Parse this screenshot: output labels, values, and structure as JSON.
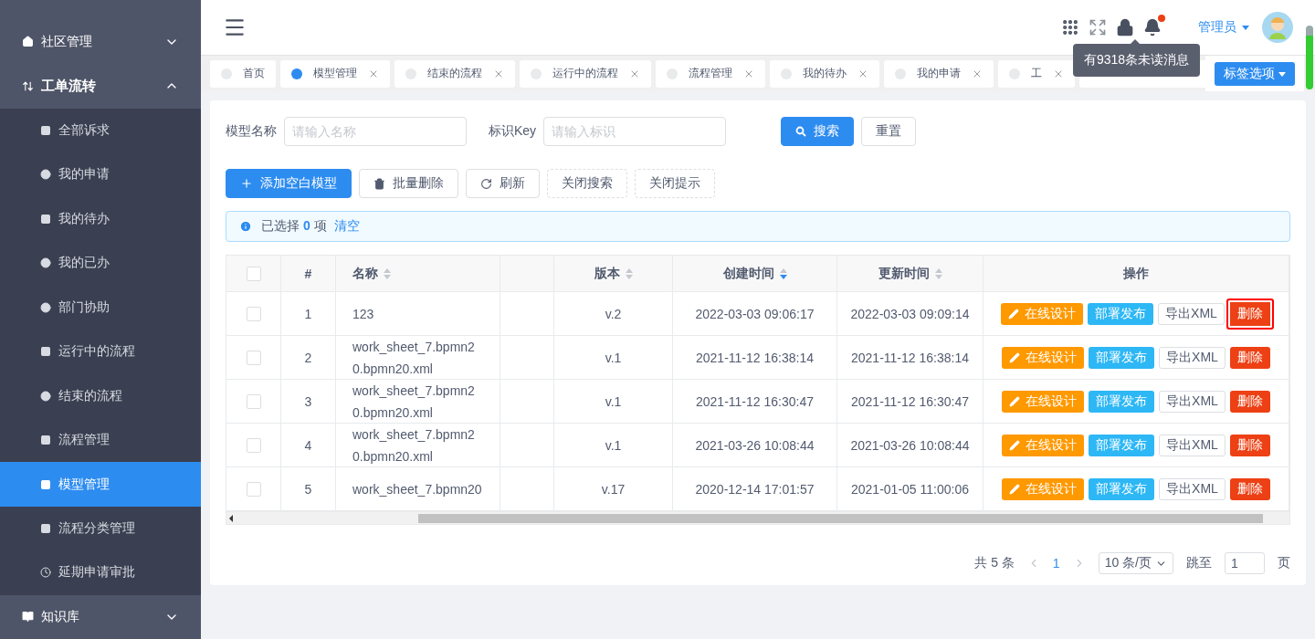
{
  "sidebar": {
    "items": [
      {
        "label": "社区管理",
        "expanded": false
      },
      {
        "label": "工单流转",
        "expanded": true,
        "children": [
          {
            "label": "全部诉求",
            "selected": false
          },
          {
            "label": "我的申请",
            "selected": false
          },
          {
            "label": "我的待办",
            "selected": false
          },
          {
            "label": "我的已办",
            "selected": false
          },
          {
            "label": "部门协助",
            "selected": false
          },
          {
            "label": "运行中的流程",
            "selected": false
          },
          {
            "label": "结束的流程",
            "selected": false
          },
          {
            "label": "流程管理",
            "selected": false
          },
          {
            "label": "模型管理",
            "selected": true
          },
          {
            "label": "流程分类管理",
            "selected": false
          },
          {
            "label": "延期申请审批",
            "selected": false
          }
        ]
      },
      {
        "label": "知识库",
        "expanded": false
      }
    ]
  },
  "header": {
    "user": "管理员",
    "notification_tooltip": "有9318条未读消息",
    "has_unread": true
  },
  "tabs": [
    {
      "label": "首页",
      "selected": false,
      "closable": false
    },
    {
      "label": "模型管理",
      "selected": true,
      "closable": true
    },
    {
      "label": "结束的流程",
      "selected": false,
      "closable": true
    },
    {
      "label": "运行中的流程",
      "selected": false,
      "closable": true
    },
    {
      "label": "流程管理",
      "selected": false,
      "closable": true
    },
    {
      "label": "我的待办",
      "selected": false,
      "closable": true
    },
    {
      "label": "我的申请",
      "selected": false,
      "closable": true
    },
    {
      "label": "工",
      "selected": false,
      "closable": true
    }
  ],
  "tab_options": "标签选项",
  "search": {
    "fields": [
      {
        "label": "模型名称",
        "placeholder": "请输入名称"
      },
      {
        "label": "标识Key",
        "placeholder": "请输入标识"
      }
    ],
    "search_button": "搜索",
    "reset_button": "重置"
  },
  "toolbar": [
    {
      "label": "添加空白模型",
      "kind": "primary"
    },
    {
      "label": "批量删除",
      "kind": "trash"
    },
    {
      "label": "刷新",
      "kind": "refresh"
    },
    {
      "label": "关闭搜索",
      "kind": "dashed"
    },
    {
      "label": "关闭提示",
      "kind": "dashed"
    }
  ],
  "selection_alert": {
    "prefix": "已选择",
    "count": "0",
    "suffix": "项",
    "clear": "清空"
  },
  "table": {
    "all_checked": false,
    "columns": [
      {
        "kind": "select"
      },
      {
        "label": "#"
      },
      {
        "label": "名称",
        "sorted_descending": false
      },
      {
        "kind": "blank"
      },
      {
        "label": "版本",
        "sorted_descending": false
      },
      {
        "label": "创建时间",
        "sorted_descending": true
      },
      {
        "label": "更新时间",
        "sorted_descending": false
      },
      {
        "label": "操作"
      }
    ],
    "rows": [
      {
        "checked": false,
        "index": "1",
        "name": "123",
        "version": "v.2",
        "created": "2022-03-03 09:06:17",
        "updated": "2022-03-03 09:09:14",
        "highlighted": true,
        "actions": [
          {
            "label": "在线设计",
            "kind": "design"
          },
          {
            "label": "部署发布",
            "kind": "deploy"
          },
          {
            "label": "导出XML",
            "kind": "export"
          },
          {
            "label": "删除",
            "kind": "delete"
          }
        ]
      },
      {
        "checked": false,
        "index": "2",
        "name": "work_sheet_7.bpmn20.bpmn20.xml",
        "version": "v.1",
        "created": "2021-11-12 16:38:14",
        "updated": "2021-11-12 16:38:14",
        "highlighted": false,
        "actions": [
          {
            "label": "在线设计",
            "kind": "design"
          },
          {
            "label": "部署发布",
            "kind": "deploy"
          },
          {
            "label": "导出XML",
            "kind": "export"
          },
          {
            "label": "删除",
            "kind": "delete"
          }
        ]
      },
      {
        "checked": false,
        "index": "3",
        "name": "work_sheet_7.bpmn20.bpmn20.xml",
        "version": "v.1",
        "created": "2021-11-12 16:30:47",
        "updated": "2021-11-12 16:30:47",
        "highlighted": false,
        "actions": [
          {
            "label": "在线设计",
            "kind": "design"
          },
          {
            "label": "部署发布",
            "kind": "deploy"
          },
          {
            "label": "导出XML",
            "kind": "export"
          },
          {
            "label": "删除",
            "kind": "delete"
          }
        ]
      },
      {
        "checked": false,
        "index": "4",
        "name": "work_sheet_7.bpmn20.bpmn20.xml",
        "version": "v.1",
        "created": "2021-03-26 10:08:44",
        "updated": "2021-03-26 10:08:44",
        "highlighted": false,
        "actions": [
          {
            "label": "在线设计",
            "kind": "design"
          },
          {
            "label": "部署发布",
            "kind": "deploy"
          },
          {
            "label": "导出XML",
            "kind": "export"
          },
          {
            "label": "删除",
            "kind": "delete"
          }
        ]
      },
      {
        "checked": false,
        "index": "5",
        "name": "work_sheet_7.bpmn20",
        "version": "v.17",
        "created": "2020-12-14 17:01:57",
        "updated": "2021-01-05 11:00:06",
        "highlighted": false,
        "actions": [
          {
            "label": "在线设计",
            "kind": "design"
          },
          {
            "label": "部署发布",
            "kind": "deploy"
          },
          {
            "label": "导出XML",
            "kind": "export"
          },
          {
            "label": "删除",
            "kind": "delete"
          }
        ]
      }
    ]
  },
  "pagination": {
    "total": "共 5 条",
    "current": "1",
    "page_size": "10 条/页",
    "jump_label": "跳至",
    "jump_value": "1",
    "page_suffix": "页"
  }
}
